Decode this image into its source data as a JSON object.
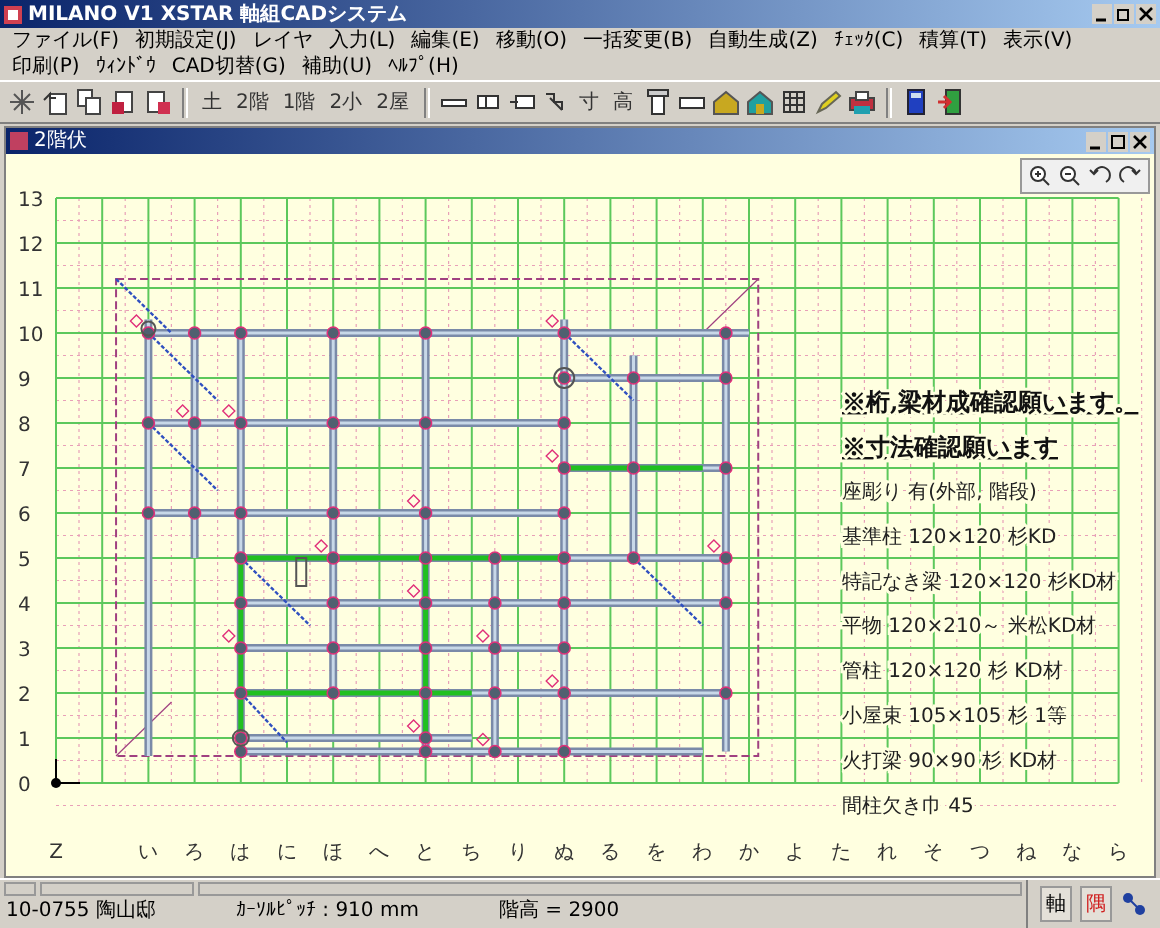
{
  "window": {
    "title": "MILANO V1 XSTAR 軸組CADシステム"
  },
  "menu": [
    "ファイル(F)",
    "初期設定(J)",
    "レイヤ",
    "入力(L)",
    "編集(E)",
    "移動(O)",
    "一括変更(B)",
    "自動生成(Z)",
    "ﾁｪｯｸ(C)",
    "積算(T)",
    "表示(V)",
    "印刷(P)",
    "ｳｨﾝﾄﾞｳ",
    "CAD切替(G)",
    "補助(U)",
    "ﾍﾙﾌﾟ(H)"
  ],
  "toolbar": {
    "floor_buttons": [
      "土",
      "2階",
      "1階",
      "2小",
      "2屋"
    ],
    "member_buttons": [
      "寸",
      "高"
    ]
  },
  "document": {
    "title": "2階伏"
  },
  "grid": {
    "rows": [
      "13",
      "12",
      "11",
      "10",
      "9",
      "8",
      "7",
      "6",
      "5",
      "4",
      "3",
      "2",
      "1",
      "0"
    ],
    "columns": [
      "Z",
      "い",
      "ろ",
      "は",
      "に",
      "ほ",
      "へ",
      "と",
      "ち",
      "り",
      "ぬ",
      "る",
      "を",
      "わ",
      "か",
      "よ",
      "た",
      "れ",
      "そ",
      "つ",
      "ね",
      "な",
      "ら"
    ]
  },
  "notes": {
    "headings": [
      "※桁,梁材成確認願います。",
      "※寸法確認願います"
    ],
    "specs": [
      [
        "座彫り 有(外部, 階段)"
      ],
      [
        "基準柱 120×120 杉KD",
        "特記なき梁 120×120 杉KD材"
      ],
      [
        "平物 120×210～ 米松KD材"
      ],
      [
        "管柱 120×120 杉 KD材"
      ],
      [
        "小屋束 105×105 杉 1等"
      ],
      [
        "火打梁 90×90 杉 KD材"
      ],
      [
        "間柱欠き巾 45"
      ]
    ]
  },
  "status_bar": {
    "fields": [
      "10-0755 陶山邸",
      "ｶｰｿﾙﾋﾟｯﾁ : 910 mm",
      "階高 = 2900"
    ],
    "buttons": [
      "軸",
      "隅"
    ]
  }
}
